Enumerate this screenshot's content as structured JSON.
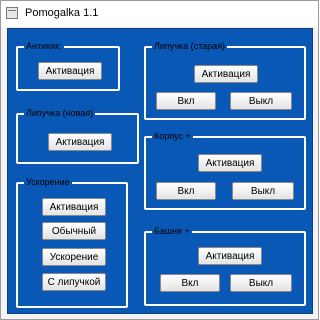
{
  "window": {
    "title": "Pomogalka 1.1"
  },
  "groups": {
    "antikik": {
      "label": "Антикик:",
      "activate": "Активация"
    },
    "lipuchka_old": {
      "label": "Липучка (старая)",
      "activate": "Активация",
      "on": "Вкл",
      "off": "Выкл"
    },
    "lipuchka_new": {
      "label": "Липучка (новая)",
      "activate": "Активация"
    },
    "korpus": {
      "label": "Корпус +",
      "activate": "Активация",
      "on": "Вкл",
      "off": "Выкл"
    },
    "uskorenie": {
      "label": "Ускорение",
      "activate": "Активация",
      "normal": "Обычный",
      "accel": "Ускорение",
      "sticky": "С липучкой"
    },
    "bashnya": {
      "label": "Башня +",
      "activate": "Активация",
      "on": "Вкл",
      "off": "Выкл"
    }
  },
  "colors": {
    "client_background": "#0a58b5",
    "group_border": "#ffffff"
  }
}
